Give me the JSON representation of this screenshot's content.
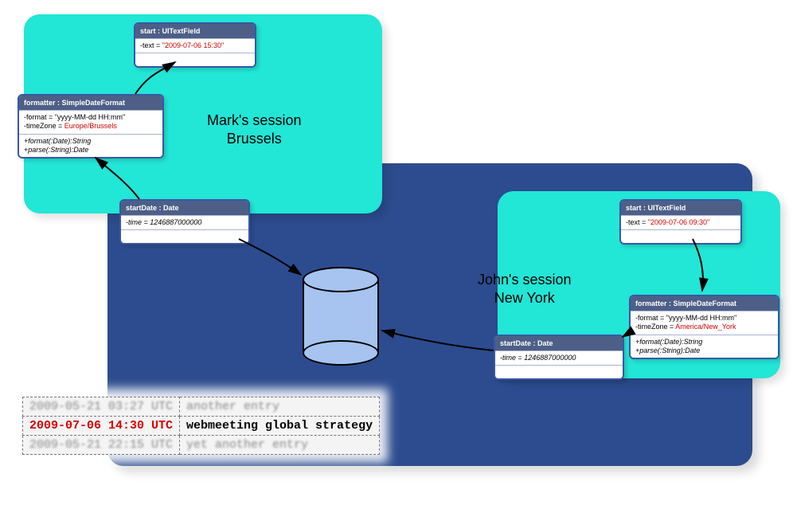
{
  "sessions": {
    "mark": {
      "label": "Mark's session\nBrussels"
    },
    "john": {
      "label": "John's session\nNew York"
    }
  },
  "objects": {
    "mark_start": {
      "header": "start : UITextField",
      "attr_prefix": "-text = ",
      "attr_value": "\"2009-07-06 15:30\""
    },
    "mark_formatter": {
      "header": "formatter : SimpleDateFormat",
      "attr_line1_prefix": "-format = ",
      "attr_line1_value": "\"yyyy-MM-dd HH:mm\"",
      "attr_line2_prefix": "-timeZone = ",
      "attr_line2_value": "Europe/Brussels",
      "method1": "+format(:Date):String",
      "method2": "+parse(:String):Date"
    },
    "mark_date": {
      "header": "startDate : Date",
      "attr_prefix": "-time = ",
      "attr_value": "1246887000000"
    },
    "john_start": {
      "header": "start : UITextField",
      "attr_prefix": "-text = ",
      "attr_value": "\"2009-07-06 09:30\""
    },
    "john_formatter": {
      "header": "formatter : SimpleDateFormat",
      "attr_line1_prefix": "-format = ",
      "attr_line1_value": "\"yyyy-MM-dd HH:mm\"",
      "attr_line2_prefix": "-timeZone = ",
      "attr_line2_value": "America/New_York",
      "method1": "+format(:Date):String",
      "method2": "+parse(:String):Date"
    },
    "john_date": {
      "header": "startDate : Date",
      "attr_prefix": "-time = ",
      "attr_value": "1246887000000"
    }
  },
  "db_rows": [
    {
      "time": "2009-05-21 03:27 UTC",
      "desc": "another entry",
      "focus": false
    },
    {
      "time": "2009-07-06 14:30 UTC",
      "desc": "webmeeting global strategy",
      "focus": true
    },
    {
      "time": "2009-05-21 22:15 UTC",
      "desc": "yet another entry",
      "focus": false
    }
  ]
}
